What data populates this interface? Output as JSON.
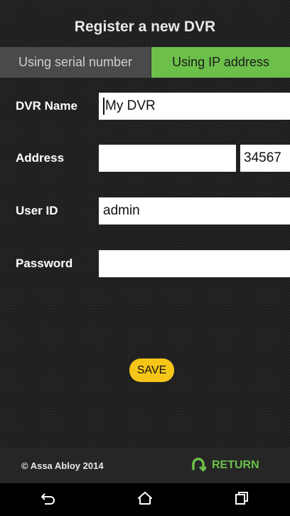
{
  "header": {
    "title": "Register a new DVR"
  },
  "tabs": [
    {
      "label": "Using serial number",
      "active": false
    },
    {
      "label": "Using IP address",
      "active": true
    }
  ],
  "form": {
    "dvr_name": {
      "label": "DVR Name",
      "value": "My DVR"
    },
    "address": {
      "label": "Address",
      "value": "",
      "port": "34567"
    },
    "user_id": {
      "label": "User ID",
      "value": "admin"
    },
    "password": {
      "label": "Password",
      "value": ""
    }
  },
  "actions": {
    "save_label": "SAVE",
    "return_label": "RETURN"
  },
  "footer": {
    "copyright": "© Assa Abloy 2014"
  },
  "navbar": {
    "icons": [
      "back-icon",
      "home-icon",
      "recents-icon"
    ]
  },
  "colors": {
    "accent": "#6cc04a",
    "save": "#f5c518",
    "background": "#1a1a1a"
  }
}
